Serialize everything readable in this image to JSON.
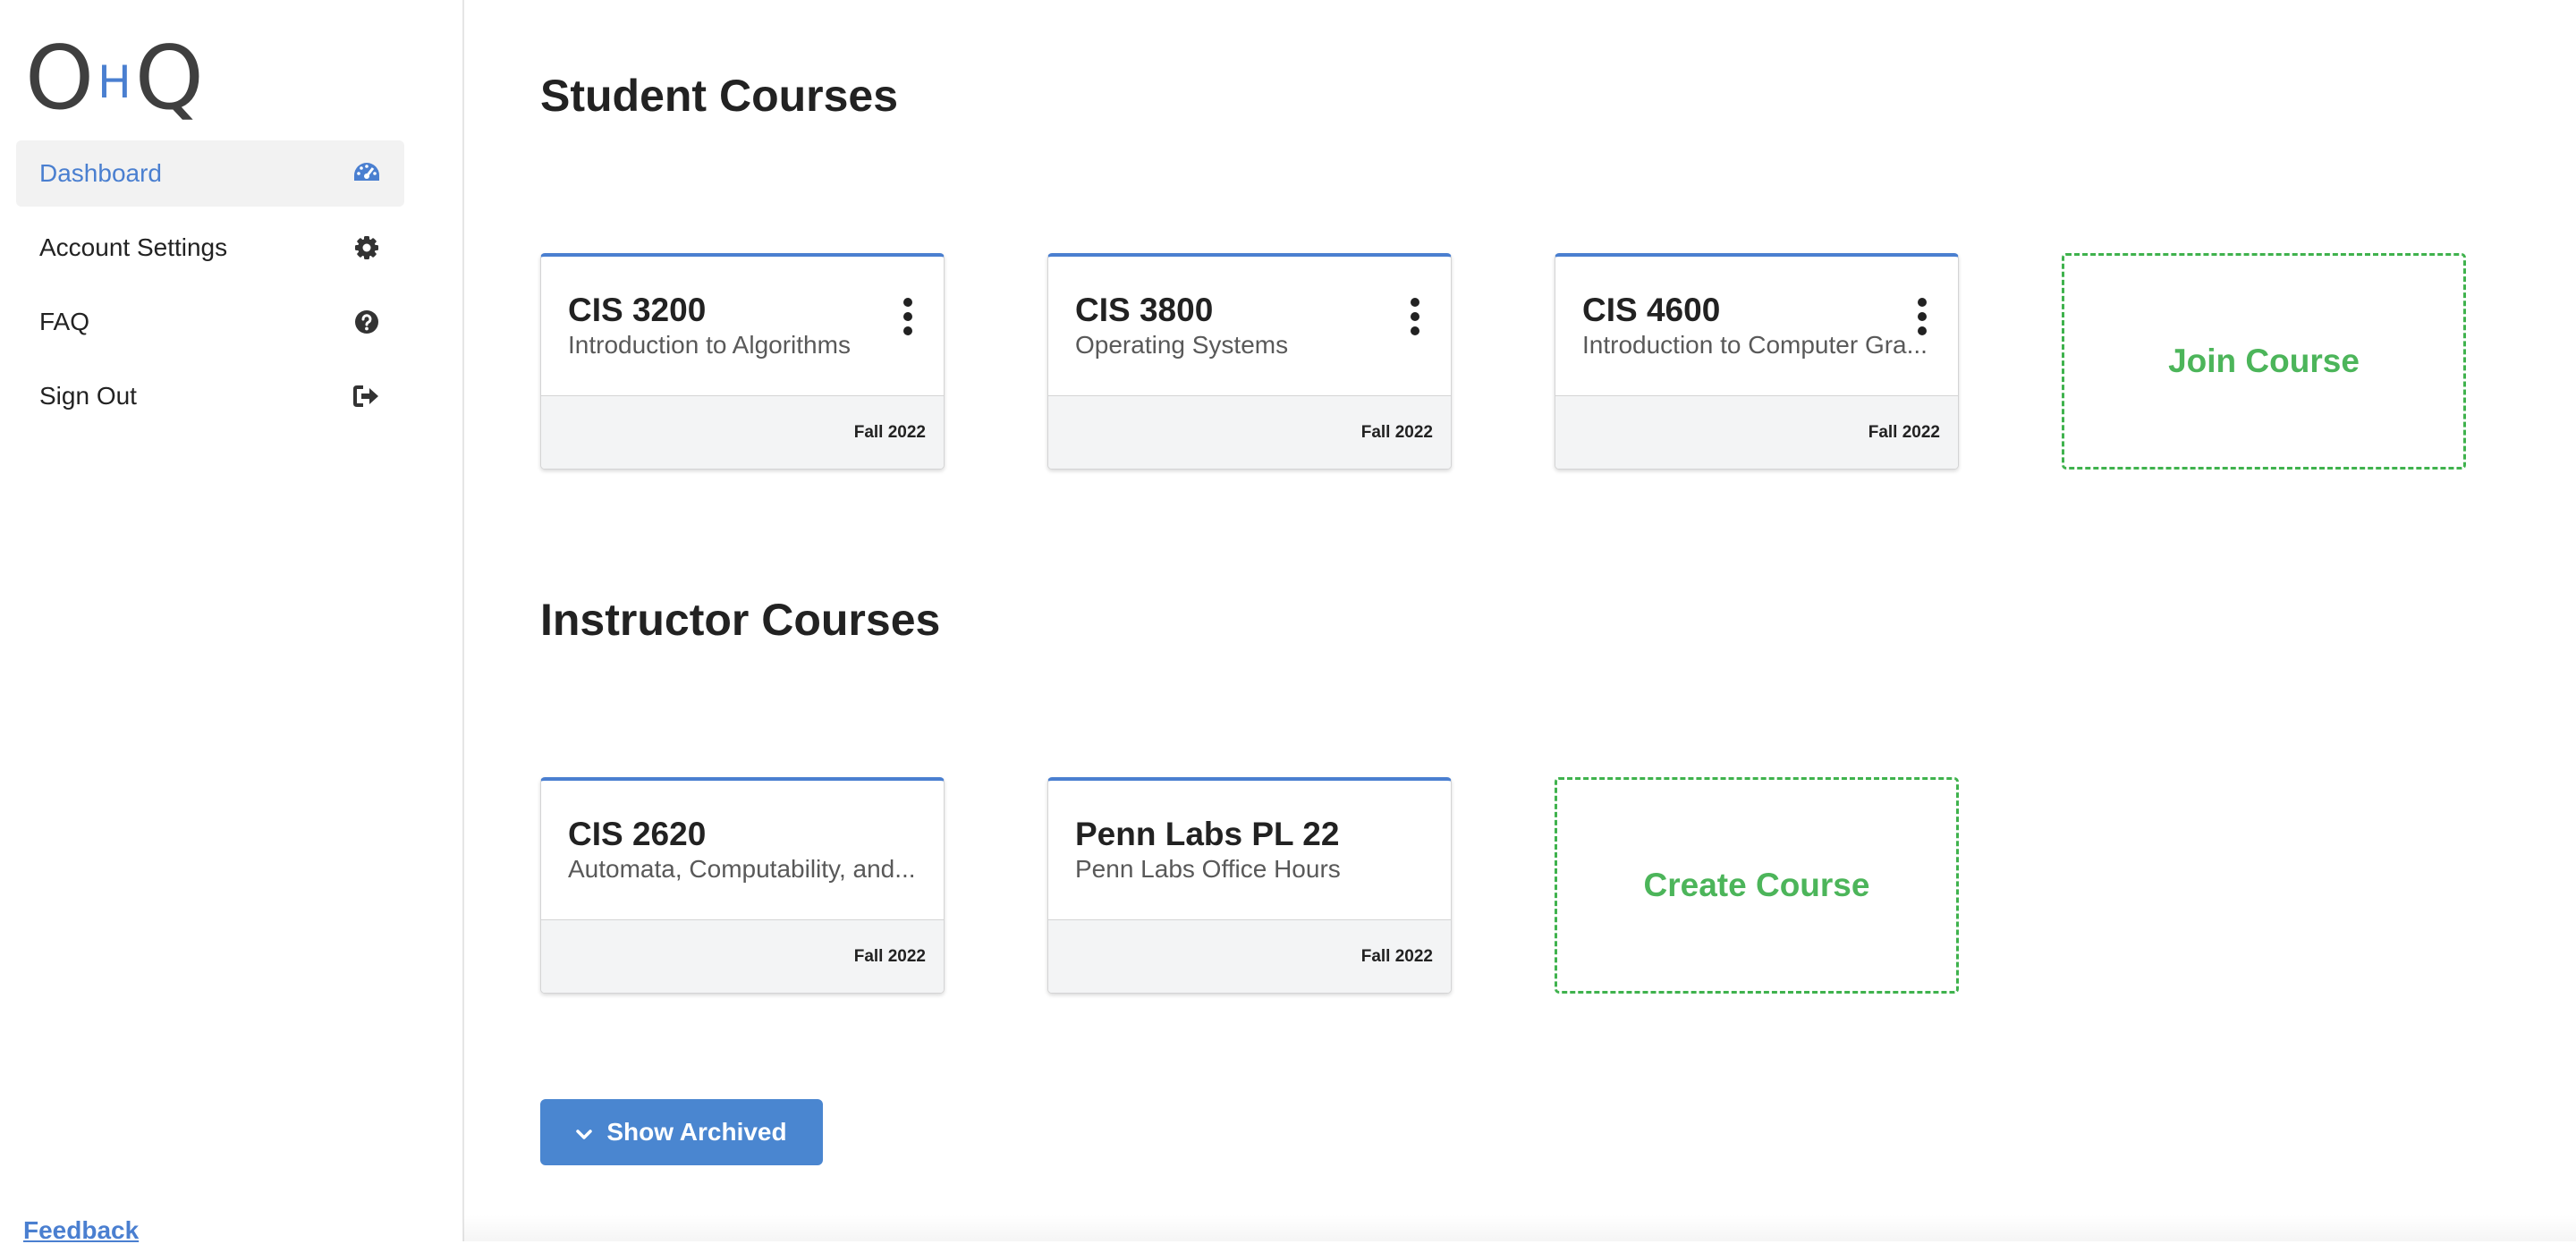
{
  "logo": {
    "left": "O",
    "middle": "H",
    "right": "Q"
  },
  "sidebar": {
    "items": [
      {
        "label": "Dashboard",
        "icon": "dashboard-gauge-icon",
        "active": true
      },
      {
        "label": "Account Settings",
        "icon": "gear-icon",
        "active": false
      },
      {
        "label": "FAQ",
        "icon": "question-circle-icon",
        "active": false
      },
      {
        "label": "Sign Out",
        "icon": "sign-out-icon",
        "active": false
      }
    ],
    "feedback": "Feedback"
  },
  "student": {
    "title": "Student Courses",
    "courses": [
      {
        "code": "CIS 3200",
        "name": "Introduction to Algorithms",
        "term": "Fall 2022"
      },
      {
        "code": "CIS 3800",
        "name": "Operating Systems",
        "term": "Fall 2022"
      },
      {
        "code": "CIS 4600",
        "name": "Introduction to Computer Gra...",
        "term": "Fall 2022"
      }
    ],
    "join_label": "Join Course"
  },
  "instructor": {
    "title": "Instructor Courses",
    "courses": [
      {
        "code": "CIS 2620",
        "name": "Automata, Computability, and...",
        "term": "Fall 2022"
      },
      {
        "code": "Penn Labs PL 22",
        "name": "Penn Labs Office Hours",
        "term": "Fall 2022"
      }
    ],
    "create_label": "Create Course"
  },
  "archive_button": "Show Archived",
  "colors": {
    "accent": "#4a7fd0",
    "add": "#4cb55a",
    "button": "#4a86d0"
  }
}
